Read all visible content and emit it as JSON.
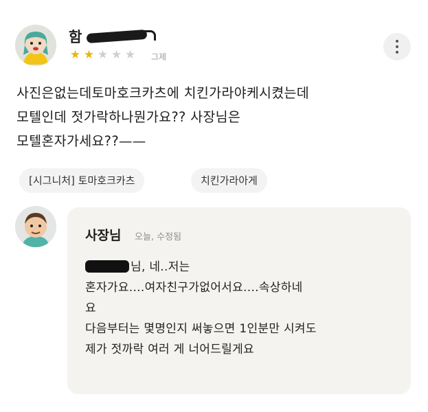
{
  "review": {
    "reviewer_name": "함",
    "rating": 2,
    "rating_max": 5,
    "date": "그제",
    "text_lines": [
      "사진은없는데토마호크카츠에  치킨가라야케시켰는데",
      "모텔인데 젓가락하나뭔가요?? 사장님은",
      "모텔혼자가세요??——"
    ],
    "tags": [
      "[시그니처] 토마호크카츠",
      "치킨가라아게"
    ]
  },
  "reply": {
    "author": "사장님",
    "meta": "오늘, 수정됨",
    "lines": [
      "님, 네..저는",
      "혼자가요....여자친구가없어서요....속상하네",
      "요",
      "다음부터는 몇명인지 써놓으면 1인분만 시켜도",
      "제가 젓까락 여러 게 너어드릴게요"
    ]
  },
  "icons": {
    "more": "more-vertical-icon",
    "star": "star-icon"
  },
  "colors": {
    "star_on": "#e8b60c",
    "star_off": "#cfcfcf",
    "reply_bg": "#f5f3ef",
    "tag_bg": "#f3f3f3"
  }
}
